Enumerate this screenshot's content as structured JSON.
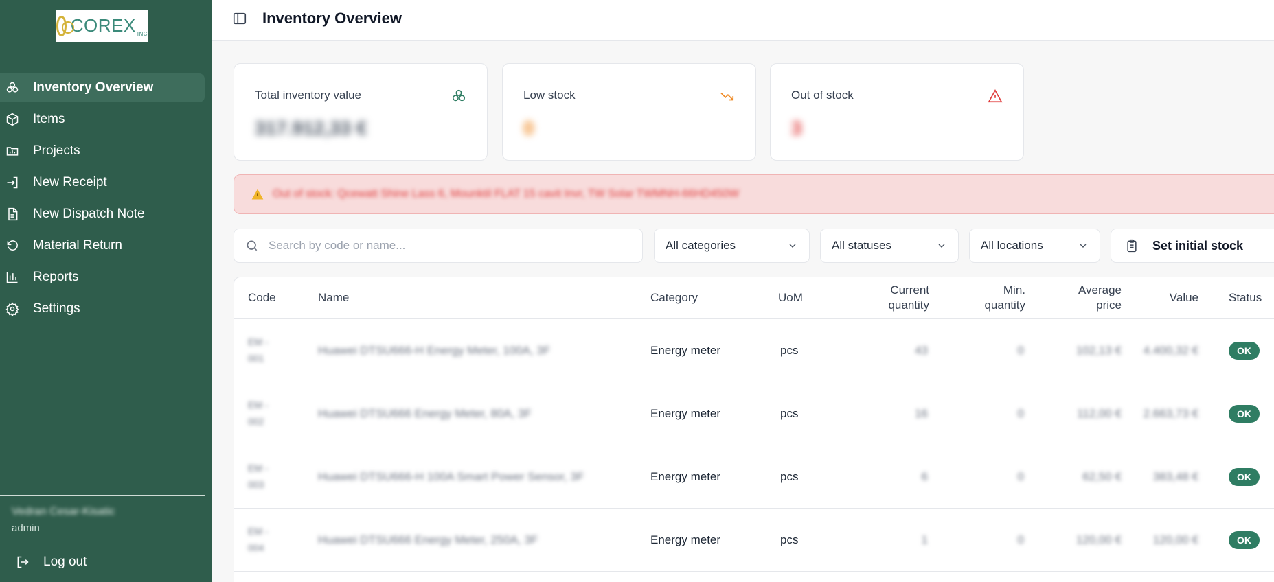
{
  "brand": {
    "logo_text": "COREX",
    "logo_suffix": "INC"
  },
  "sidebar": {
    "items": [
      {
        "label": "Inventory Overview",
        "icon": "boxes-icon",
        "active": true
      },
      {
        "label": "Items",
        "icon": "package-icon",
        "active": false
      },
      {
        "label": "Projects",
        "icon": "folder-chart-icon",
        "active": false
      },
      {
        "label": "New Receipt",
        "icon": "login-arrow-icon",
        "active": false
      },
      {
        "label": "New Dispatch Note",
        "icon": "file-icon",
        "active": false
      },
      {
        "label": "Material Return",
        "icon": "rotate-ccw-icon",
        "active": false
      },
      {
        "label": "Reports",
        "icon": "bar-chart-icon",
        "active": false
      },
      {
        "label": "Settings",
        "icon": "gear-icon",
        "active": false
      }
    ],
    "user": {
      "name": "Vedran Cesar-Kisatic",
      "role": "admin"
    },
    "logout_label": "Log out"
  },
  "header": {
    "title": "Inventory Overview"
  },
  "cards": [
    {
      "label": "Total inventory value",
      "value": "317.912,33 €",
      "icon": "boxes-icon",
      "color": "#2f7d63"
    },
    {
      "label": "Low stock",
      "value": "0",
      "icon": "trending-down-icon",
      "color": "#f08a24"
    },
    {
      "label": "Out of stock",
      "value": "3",
      "icon": "alert-triangle-icon",
      "color": "#e03b3b"
    }
  ],
  "alert": {
    "text": "Out of stock: Qcewatt Shine Lass 6, Mounktil FLAT 15 cavit Invr, TW Solar TWMNH-66HD450W"
  },
  "filters": {
    "search_placeholder": "Search by code or name...",
    "category": "All categories",
    "status": "All statuses",
    "location": "All locations",
    "initial_stock_label": "Set initial stock"
  },
  "table": {
    "headers": {
      "code": "Code",
      "name": "Name",
      "category": "Category",
      "uom": "UoM",
      "current_qty": "Current quantity",
      "min_qty": "Min. quantity",
      "avg_price": "Average price",
      "value": "Value",
      "status": "Status"
    },
    "rows": [
      {
        "code": "EM - 001",
        "name": "Huawei DTSU666-H Energy Meter, 100A, 3F",
        "category": "Energy meter",
        "uom": "pcs",
        "current_qty": "43",
        "min_qty": "0",
        "avg_price": "102,13 €",
        "value": "4.400,32 €",
        "status": "OK"
      },
      {
        "code": "EM - 002",
        "name": "Huawei DTSU666 Energy Meter, 80A, 3F",
        "category": "Energy meter",
        "uom": "pcs",
        "current_qty": "16",
        "min_qty": "0",
        "avg_price": "112,00 €",
        "value": "2.663,73 €",
        "status": "OK"
      },
      {
        "code": "EM - 003",
        "name": "Huawei DTSU666-H 100A Smart Power Sensor, 3F",
        "category": "Energy meter",
        "uom": "pcs",
        "current_qty": "6",
        "min_qty": "0",
        "avg_price": "62,50 €",
        "value": "383,48 €",
        "status": "OK"
      },
      {
        "code": "EM - 004",
        "name": "Huawei DTSU666 Energy Meter, 250A, 3F",
        "category": "Energy meter",
        "uom": "pcs",
        "current_qty": "1",
        "min_qty": "0",
        "avg_price": "120,00 €",
        "value": "120,00 €",
        "status": "OK"
      }
    ]
  }
}
